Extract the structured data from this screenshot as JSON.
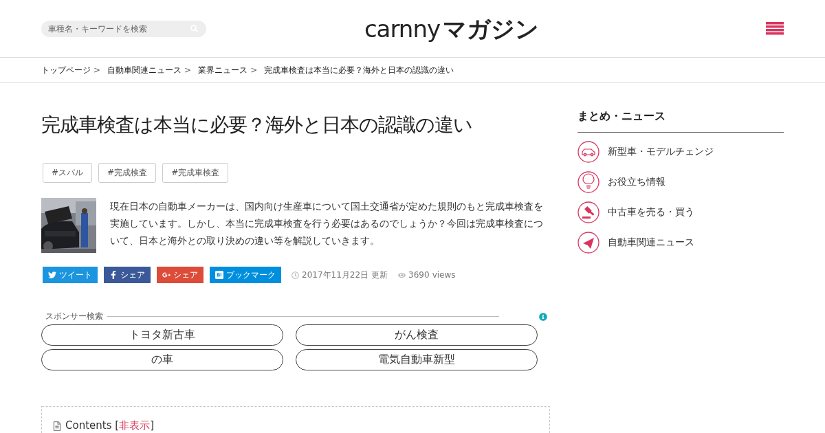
{
  "header": {
    "search": {
      "placeholder": "車種名・キーワードを検索"
    },
    "logo": {
      "latin": "carnny",
      "kana": "マガジン"
    }
  },
  "breadcrumbs": [
    {
      "label": "トップページ",
      "separator": ">"
    },
    {
      "label": "自動車関連ニュース",
      "separator": ">"
    },
    {
      "label": "業界ニュース",
      "separator": ">"
    },
    {
      "label": "完成車検査は本当に必要？海外と日本の認識の違い"
    }
  ],
  "article": {
    "title": "完成車検査は本当に必要？海外と日本の認識の違い",
    "tags": [
      "#スバル",
      "#完成検査",
      "#完成車検査"
    ],
    "thumbnail": {
      "kind": "picture"
    },
    "lead": "現在日本の自動車メーカーは、国内向け生産車について国土交通省が定めた規則のもと完成車検査を実施しています。しかし、本当に完成車検査を行う必要はあるのでしょうか？今回は完成車検査について、日本と海外との取り決めの違い等を解説していきます。",
    "share": [
      {
        "kind": "twitter",
        "label": "ツイート",
        "color": "#1b95e0"
      },
      {
        "kind": "facebook",
        "label": "シェア",
        "color": "#3b5998"
      },
      {
        "kind": "google",
        "label": "シェア",
        "color": "#dd4b39"
      },
      {
        "kind": "hatena",
        "label": "ブックマーク",
        "color": "#008fde"
      }
    ],
    "date": "2017年11月22日",
    "updated": "更新",
    "views": "3690",
    "views_label": "views"
  },
  "sponsor": {
    "label": "スポンサー検索",
    "links": [
      "トヨタ新古車",
      "がん検査",
      "の車",
      "電気自動車新型"
    ]
  },
  "contents": {
    "title": "Contents",
    "bracket_open": "[",
    "toggle": "非表示",
    "bracket_close": "]"
  },
  "sidebar": {
    "heading": "まとめ・ニュース",
    "items": [
      {
        "kind": "car",
        "label": "新型車・モデルチェンジ"
      },
      {
        "kind": "bulb",
        "label": "お役立ち情報"
      },
      {
        "kind": "gavel",
        "label": "中古車を売る・買う"
      },
      {
        "kind": "plane",
        "label": "自動車関連ニュース"
      }
    ]
  }
}
